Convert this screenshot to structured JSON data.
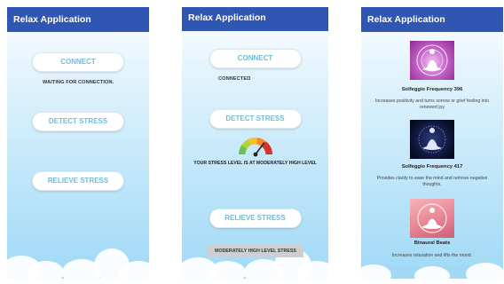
{
  "screen1": {
    "title": "Relax Application",
    "connect_label": "CONNECT",
    "status": "WAITING FOR CONNECTION.",
    "detect_label": "DETECT STRESS",
    "relieve_label": "RELIEVE STRESS"
  },
  "screen2": {
    "title": "Relax Application",
    "connect_label": "CONNECT",
    "status": "CONNECTED",
    "detect_label": "DETECT STRESS",
    "stress_level_text": "YOUR STRESS LEVEL IS AT MODERATELY HIGH LEVEL",
    "gauge_level": 0.7,
    "relieve_label": "RELIEVE STRESS",
    "stress_button_label": "MODERATELY HIGH LEVEL STRESS"
  },
  "screen3": {
    "title": "Relax Application",
    "items": [
      {
        "name": "Solfeggio Frequency 396",
        "description": "Increases positivity and turns sorrow or grief feeling into renewed joy",
        "icon": "meditation-icon"
      },
      {
        "name": "Solfeggio Frequency 417",
        "description": "Provides clarity to ease the mind and remove negative thoughts.",
        "icon": "meditation-icon"
      },
      {
        "name": "Binaural Beats",
        "description": "Increases relaxation and lifts the mood.",
        "icon": "meditation-icon"
      }
    ]
  },
  "colors": {
    "appbar": "#2f56b2",
    "button_text": "#6fbcd6",
    "sky_top": "#ffffff",
    "sky_bottom": "#9fd9f6"
  }
}
